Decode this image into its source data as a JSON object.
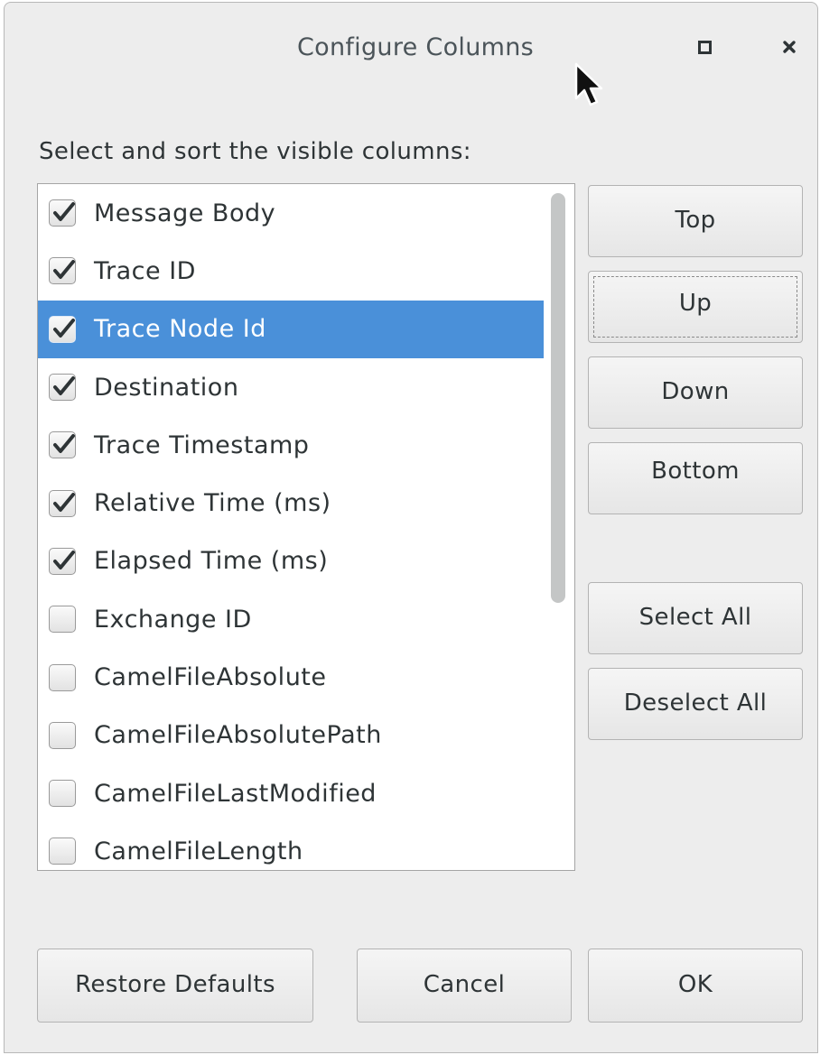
{
  "dialog": {
    "title": "Configure Columns",
    "prompt": "Select and sort the visible columns:"
  },
  "icons": {
    "maximize": "maximize-icon",
    "close": "close-icon",
    "check": "checkmark-icon",
    "cursor": "mouse-pointer-icon"
  },
  "colors": {
    "selection": "#4a90d9",
    "dialog_bg": "#ededed"
  },
  "columns": [
    {
      "label": "Message Body",
      "checked": true,
      "selected": false
    },
    {
      "label": "Trace ID",
      "checked": true,
      "selected": false
    },
    {
      "label": "Trace Node Id",
      "checked": true,
      "selected": true
    },
    {
      "label": "Destination",
      "checked": true,
      "selected": false
    },
    {
      "label": "Trace Timestamp",
      "checked": true,
      "selected": false
    },
    {
      "label": "Relative Time (ms)",
      "checked": true,
      "selected": false
    },
    {
      "label": "Elapsed Time (ms)",
      "checked": true,
      "selected": false
    },
    {
      "label": "Exchange ID",
      "checked": false,
      "selected": false
    },
    {
      "label": "CamelFileAbsolute",
      "checked": false,
      "selected": false
    },
    {
      "label": "CamelFileAbsolutePath",
      "checked": false,
      "selected": false
    },
    {
      "label": "CamelFileLastModified",
      "checked": false,
      "selected": false
    },
    {
      "label": "CamelFileLength",
      "checked": false,
      "selected": false
    }
  ],
  "side_buttons": {
    "top": "Top",
    "up": "Up",
    "down": "Down",
    "bottom": "Bottom",
    "select_all": "Select All",
    "deselect_all": "Deselect All"
  },
  "footer_buttons": {
    "restore_defaults": "Restore Defaults",
    "cancel": "Cancel",
    "ok": "OK"
  }
}
